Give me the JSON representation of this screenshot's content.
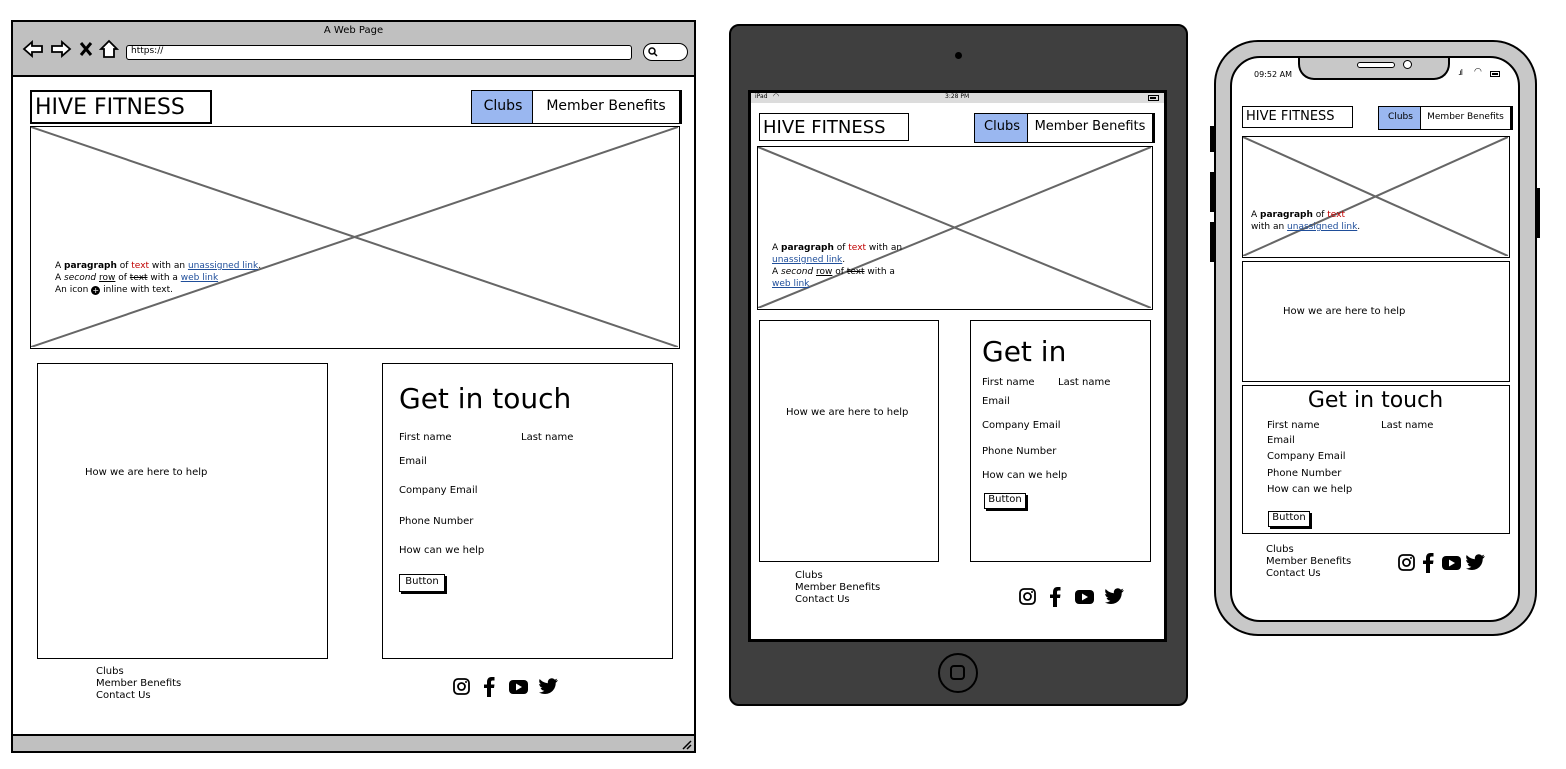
{
  "browser": {
    "title": "A Web Page",
    "url": "https://"
  },
  "brand": "HIVE FITNESS",
  "nav": {
    "clubs": "Clubs",
    "member_benefits": "Member Benefits"
  },
  "hero": {
    "p1": {
      "a": "A ",
      "bold": "paragraph",
      "of": " of ",
      "red": "text",
      "with": " with an ",
      "link": "unassigned link",
      "end": "."
    },
    "p2": {
      "a": "A ",
      "italic": "second",
      "sp": " ",
      "row": "row",
      "of": " of ",
      "strike": "text",
      "with": " with a ",
      "link": "web link"
    },
    "p3": {
      "a": "An icon ",
      "b": " inline with text."
    },
    "tablet_p2": {
      "a": "A ",
      "italic": "second",
      "sp": " ",
      "row": "row",
      "of": " of ",
      "strike": "text",
      "with": " with a"
    }
  },
  "help_text": "How we are here to help",
  "contact": {
    "title": "Get in touch",
    "tablet_title": "Get in",
    "first_name": "First name",
    "last_name": "Last name",
    "email": "Email",
    "company_email": "Company Email",
    "phone": "Phone Number",
    "help": "How can we help",
    "button": "Button"
  },
  "footer": {
    "links": [
      "Clubs",
      "Member Benefits",
      "Contact Us"
    ]
  },
  "tablet_status": {
    "device": "iPad",
    "time": "3:28 PM"
  },
  "phone_status": {
    "time": "09:52 AM"
  },
  "colors": {
    "nav_active": "#9ab7f0",
    "link": "#1f4e9a",
    "red_text": "#c00000",
    "tablet_frame": "#3f3f3f",
    "phone_frame": "#c8c8c8",
    "browser_chrome": "#c0c0c0"
  },
  "icons": [
    "instagram-icon",
    "facebook-icon",
    "youtube-icon",
    "twitter-icon"
  ]
}
